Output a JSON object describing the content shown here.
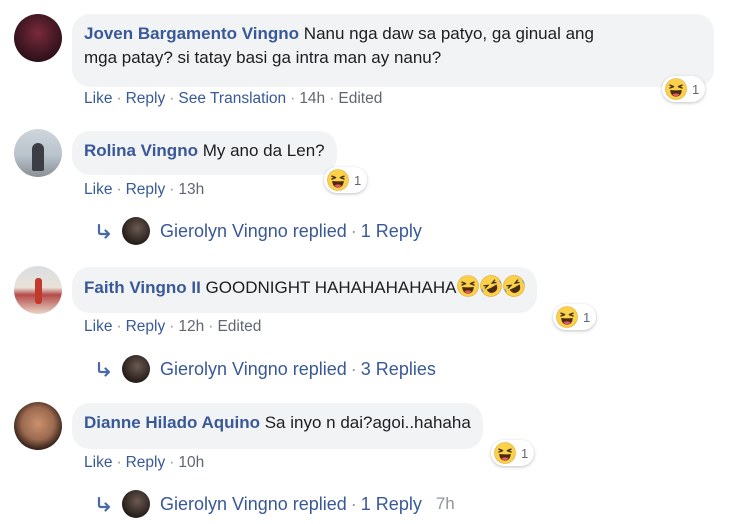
{
  "comments": [
    {
      "author": "Joven Bargamento Vingno",
      "text_line1": "Nanu nga daw sa patyo, ga ginual ang",
      "text_line2": "mga patay? si tatay basi ga intra man ay nanu?",
      "actions": {
        "like": "Like",
        "reply": "Reply",
        "translate": "See Translation",
        "time": "14h",
        "edited": "Edited"
      },
      "reaction": {
        "icon": "laugh-emoji-icon",
        "count": "1"
      }
    },
    {
      "author": "Rolina Vingno",
      "text": "My ano da Len?",
      "actions": {
        "like": "Like",
        "reply": "Reply",
        "time": "13h"
      },
      "reaction": {
        "icon": "laugh-emoji-icon",
        "count": "1"
      },
      "replies": {
        "name": "Gierolyn Vingno replied",
        "count": "1 Reply"
      }
    },
    {
      "author": "Faith Vingno II",
      "text": "GOODNIGHT HAHAHAHAHAHA",
      "inline_emojis": [
        "laugh-emoji-icon",
        "rofl-emoji-icon",
        "rofl-emoji-icon"
      ],
      "actions": {
        "like": "Like",
        "reply": "Reply",
        "time": "12h",
        "edited": "Edited"
      },
      "reaction": {
        "icon": "laugh-emoji-icon",
        "count": "1"
      },
      "replies": {
        "name": "Gierolyn Vingno replied",
        "count": "3 Replies"
      }
    },
    {
      "author": "Dianne Hilado Aquino",
      "text": "Sa inyo n dai?agoi..hahaha",
      "actions": {
        "like": "Like",
        "reply": "Reply",
        "time": "10h"
      },
      "reaction": {
        "icon": "laugh-emoji-icon",
        "count": "1"
      },
      "replies": {
        "name": "Gierolyn Vingno replied",
        "count": "1 Reply",
        "time": "7h"
      }
    }
  ],
  "colors": {
    "link": "#385898",
    "meta": "#616770",
    "bubble": "#f2f3f5",
    "emoji_face": "#fcd34d"
  }
}
